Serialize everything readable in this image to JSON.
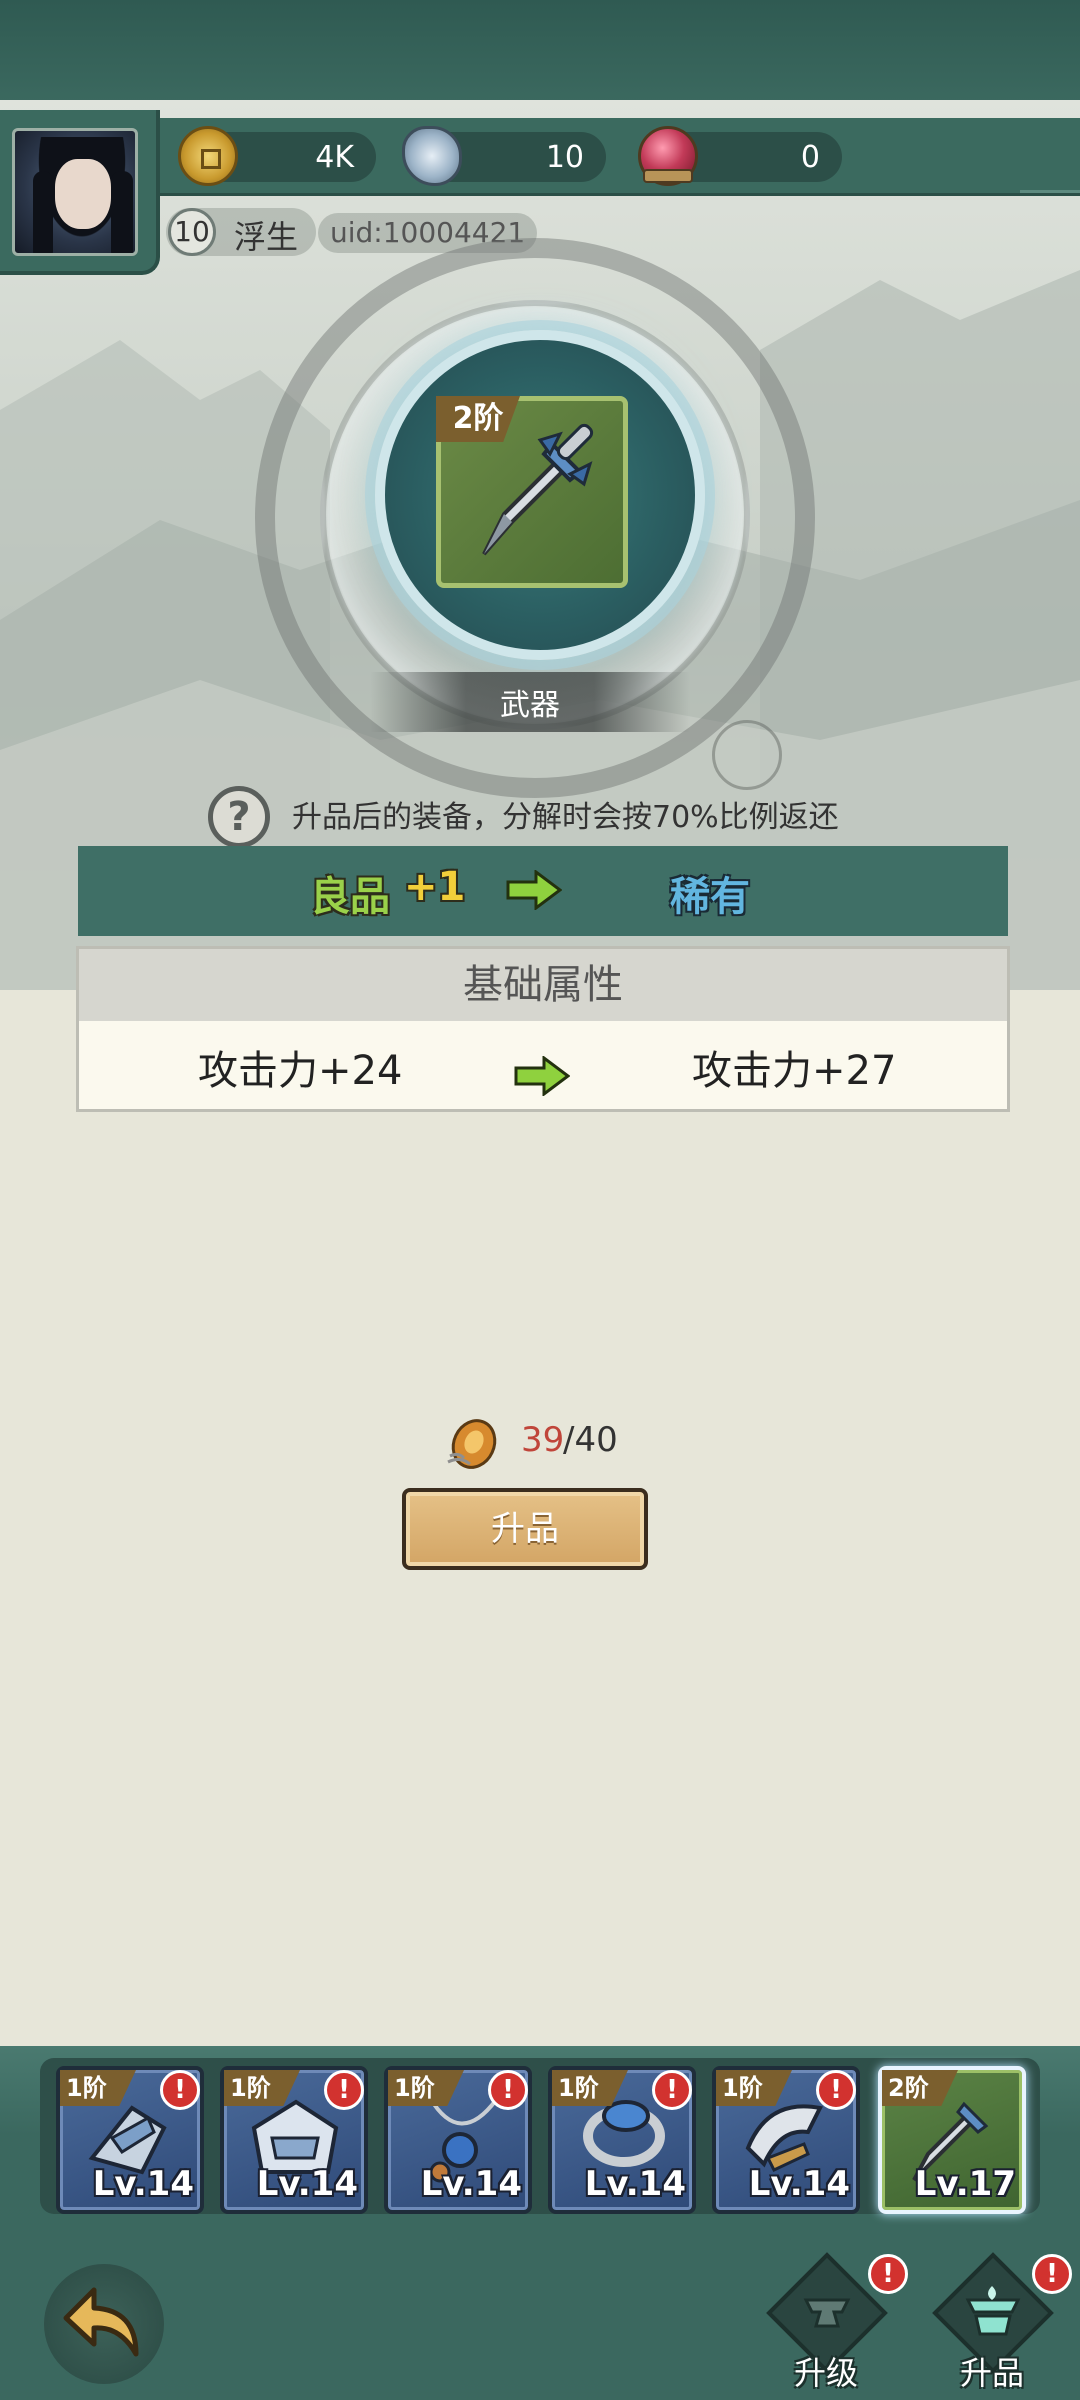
{
  "header": {
    "currencies": [
      {
        "icon": "coin-icon",
        "value": "4K"
      },
      {
        "icon": "crystal-icon",
        "value": "10"
      },
      {
        "icon": "orb-icon",
        "value": "0"
      }
    ],
    "player": {
      "level": "10",
      "name": "浮生",
      "uid": "uid:10004421"
    }
  },
  "item": {
    "tier": "2阶",
    "slot_label": "武器",
    "icon": "sword-icon"
  },
  "info_text": "升品后的装备，分解时会按70%比例返还",
  "quality": {
    "from": "良品",
    "from_bonus": "+1",
    "to": "稀有"
  },
  "attributes": {
    "title": "基础属性",
    "from": "攻击力+24",
    "to": "攻击力+27"
  },
  "cost": {
    "icon": "material-icon",
    "have": "39",
    "need": "/40"
  },
  "upgrade_button": "升品",
  "equipment": [
    {
      "tier": "1阶",
      "level": "Lv.14",
      "icon": "armor-icon",
      "alert": "!"
    },
    {
      "tier": "1阶",
      "level": "Lv.14",
      "icon": "helmet-icon",
      "alert": "!"
    },
    {
      "tier": "1阶",
      "level": "Lv.14",
      "icon": "necklace-icon",
      "alert": "!"
    },
    {
      "tier": "1阶",
      "level": "Lv.14",
      "icon": "ring-icon",
      "alert": "!"
    },
    {
      "tier": "1阶",
      "level": "Lv.14",
      "icon": "shoulder-icon",
      "alert": "!"
    },
    {
      "tier": "2阶",
      "level": "Lv.17",
      "icon": "sword-icon",
      "alert": ""
    }
  ],
  "nav": {
    "upgrade_label": "升级",
    "promote_label": "升品",
    "alert": "!"
  },
  "colors": {
    "quality_from": "#9ad14a",
    "quality_to": "#62b6e0",
    "have_count": "#c0453a",
    "panel": "#3f6f66"
  }
}
